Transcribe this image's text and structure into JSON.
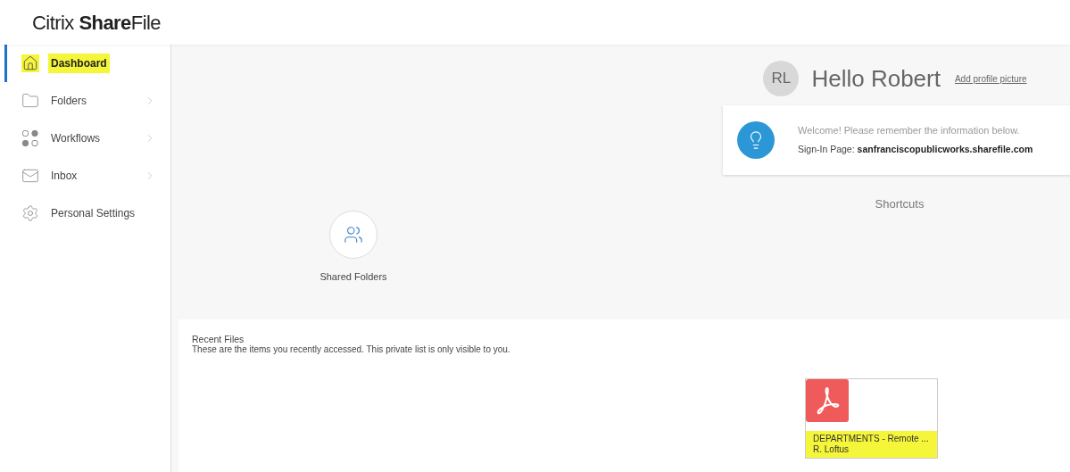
{
  "logo": {
    "light": "Citrix ",
    "bold": "Share",
    "rest": "File"
  },
  "sidebar": {
    "items": [
      {
        "kind": "home",
        "label": "Dashboard",
        "selected": true,
        "highlighted": true,
        "has_children": false
      },
      {
        "kind": "folder",
        "label": "Folders",
        "selected": false,
        "highlighted": false,
        "has_children": true
      },
      {
        "kind": "workflow",
        "label": "Workflows",
        "selected": false,
        "highlighted": false,
        "has_children": true
      },
      {
        "kind": "mail",
        "label": "Inbox",
        "selected": false,
        "highlighted": false,
        "has_children": true
      },
      {
        "kind": "gear",
        "label": "Personal Settings",
        "selected": false,
        "highlighted": false,
        "has_children": false
      }
    ]
  },
  "profile": {
    "initials": "RL",
    "greeting": "Hello Robert",
    "link": "Add profile picture"
  },
  "notice": {
    "message": "Welcome! Please remember the information below.",
    "label": "Sign-In Page:",
    "value": "sanfranciscopublicworks.sharefile.com"
  },
  "shortcuts": {
    "title": "Shortcuts",
    "items": [
      {
        "kind": "people",
        "label": "Shared Folders"
      }
    ]
  },
  "recent_files": {
    "title": "Recent Files",
    "description": "These are the items you recently accessed. This private list is only visible to you.",
    "files": [
      {
        "kind": "pdf",
        "name": "DEPARTMENTS - Remote ...",
        "owner": "R. Loftus",
        "highlighted": true
      }
    ]
  }
}
